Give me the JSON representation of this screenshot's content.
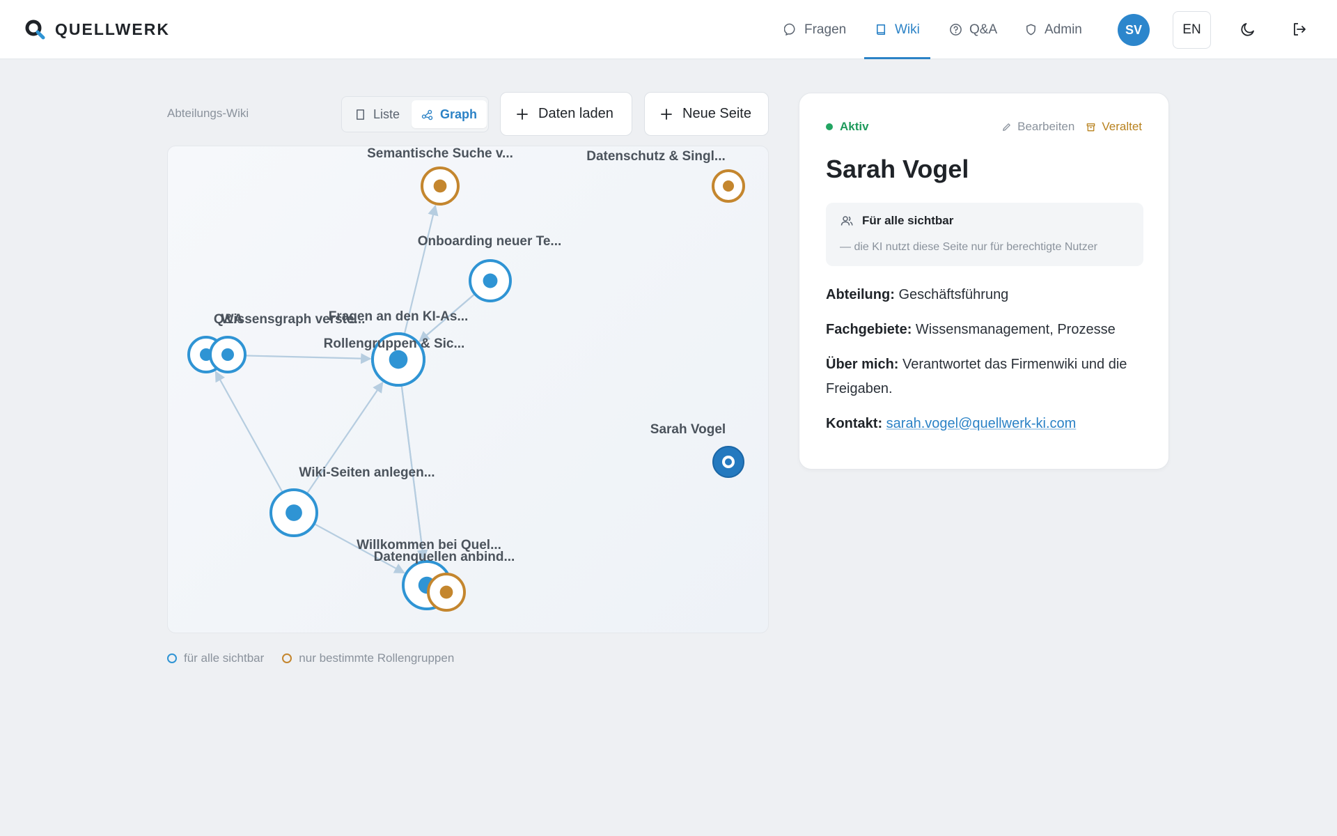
{
  "brand": {
    "name": "QUELLWERK"
  },
  "nav": {
    "items": [
      {
        "label": "Fragen",
        "icon": "chat-bubble-icon",
        "active": false
      },
      {
        "label": "Wiki",
        "icon": "book-icon",
        "active": true
      },
      {
        "label": "Q&A",
        "icon": "question-circle-icon",
        "active": false
      },
      {
        "label": "Admin",
        "icon": "shield-icon",
        "active": false
      }
    ],
    "avatar_initials": "SV",
    "language": "EN"
  },
  "toolbar": {
    "section_label": "Abteilungs-Wiki",
    "view_options": [
      {
        "label": "Liste",
        "icon": "page-icon",
        "active": false
      },
      {
        "label": "Graph",
        "icon": "graph-icon",
        "active": true
      }
    ],
    "load_data_label": "Daten laden",
    "new_page_label": "Neue Seite"
  },
  "graph": {
    "nodes": [
      {
        "label": "Semantische Suche v...",
        "visibility": "restricted"
      },
      {
        "label": "Datenschutz & Singl...",
        "visibility": "restricted"
      },
      {
        "label": "Onboarding neuer Te...",
        "visibility": "public"
      },
      {
        "label": "Q&A",
        "visibility": "public"
      },
      {
        "label": "Wissensgraph verste...",
        "visibility": "public"
      },
      {
        "label": "Fragen an den KI-As...",
        "visibility": "public"
      },
      {
        "label": "Rollengruppen & Sic...",
        "visibility": "public"
      },
      {
        "label": "Sarah Vogel",
        "visibility": "public",
        "selected": true
      },
      {
        "label": "Wiki-Seiten anlegen...",
        "visibility": "public"
      },
      {
        "label": "Willkommen bei Quel...",
        "visibility": "public"
      },
      {
        "label": "Datenquellen anbind...",
        "visibility": "restricted"
      }
    ],
    "colors": {
      "public": "#2f94d4",
      "restricted": "#c4862e",
      "edge": "#b6cde0",
      "selected_fill": "#2479bf"
    }
  },
  "legend": {
    "public_label": "für alle sichtbar",
    "restricted_label": "nur bestimmte Rollengruppen"
  },
  "detail": {
    "status": "Aktiv",
    "edit_label": "Bearbeiten",
    "outdated_label": "Veraltet",
    "title": "Sarah Vogel",
    "visibility_title": "Für alle sichtbar",
    "visibility_note": "— die KI nutzt diese Seite nur für berechtigte Nutzer",
    "department_label": "Abteilung:",
    "department_value": "Geschäftsführung",
    "expertise_label": "Fachgebiete:",
    "expertise_value": "Wissensmanagement, Prozesse",
    "about_label": "Über mich:",
    "about_value": "Verantwortet das Firmenwiki und die Freigaben.",
    "contact_label": "Kontakt:",
    "contact_value": "sarah.vogel@quellwerk-ki.com"
  }
}
